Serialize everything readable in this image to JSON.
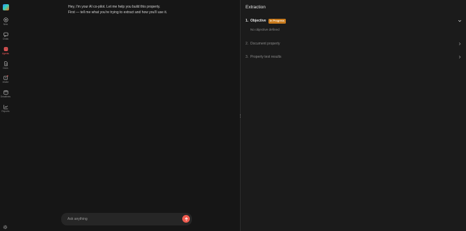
{
  "sidebar": {
    "items": [
      {
        "label": "New",
        "icon": "plus-circle-icon"
      },
      {
        "label": "Chats",
        "icon": "chat-icon"
      },
      {
        "label": "Agents",
        "icon": "agents-icon",
        "active": true
      },
      {
        "label": "Docs",
        "icon": "document-icon"
      },
      {
        "label": "Intake",
        "icon": "intake-icon"
      },
      {
        "label": "Deadlines",
        "icon": "calendar-icon"
      },
      {
        "label": "Reports",
        "icon": "chart-icon"
      }
    ],
    "settings_icon": "gear-icon"
  },
  "chat": {
    "messages": [
      "Hey, I'm your AI co-pilot. Let me help you build this property.",
      "First — tell me what you're trying to extract and how you'll use it."
    ],
    "composer": {
      "placeholder": "Ask anything",
      "send_icon": "arrow-up-icon"
    }
  },
  "panel": {
    "title": "Extraction",
    "steps": [
      {
        "num": "1.",
        "title": "Objective",
        "badge": "In Progress",
        "description": "No objective defined",
        "chevron": "chevron-down-icon"
      },
      {
        "num": "2.",
        "title": "Document property",
        "chevron": "chevron-right-icon"
      },
      {
        "num": "3.",
        "title": "Property test results",
        "chevron": "chevron-right-icon"
      }
    ]
  },
  "colors": {
    "accent": "#ef5b4f",
    "badge": "#c87a1d",
    "background": "#161616",
    "panel": "#1b1b1b"
  }
}
